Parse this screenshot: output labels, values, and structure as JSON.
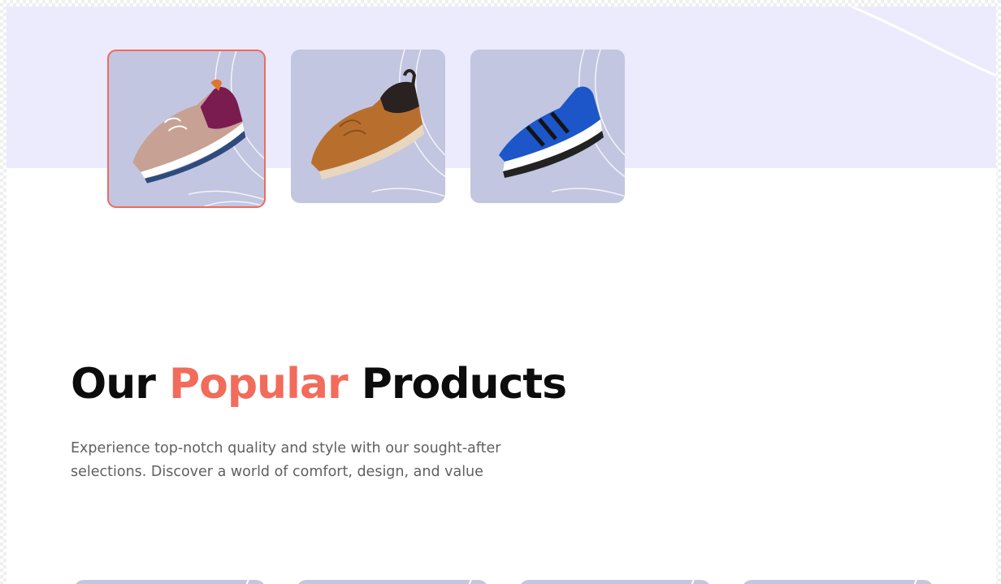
{
  "thumbnails": [
    {
      "name": "thumb-pink-sneaker",
      "selected": true,
      "icon": "sneaker-pink-icon"
    },
    {
      "name": "thumb-brown-sneaker",
      "selected": false,
      "icon": "sneaker-brown-icon"
    },
    {
      "name": "thumb-blue-sneaker",
      "selected": false,
      "icon": "sneaker-blue-icon"
    }
  ],
  "section": {
    "title_part1": "Our",
    "title_accent": "Popular",
    "title_part2": "Products",
    "description": "Experience top-notch quality and style with our sought-after selections. Discover a world of comfort, design, and value"
  },
  "colors": {
    "accent": "#f26b5b",
    "hero_bg": "#ebebfd",
    "card_bg": "#c3c6e1",
    "selected_border": "#ee6b5e"
  }
}
